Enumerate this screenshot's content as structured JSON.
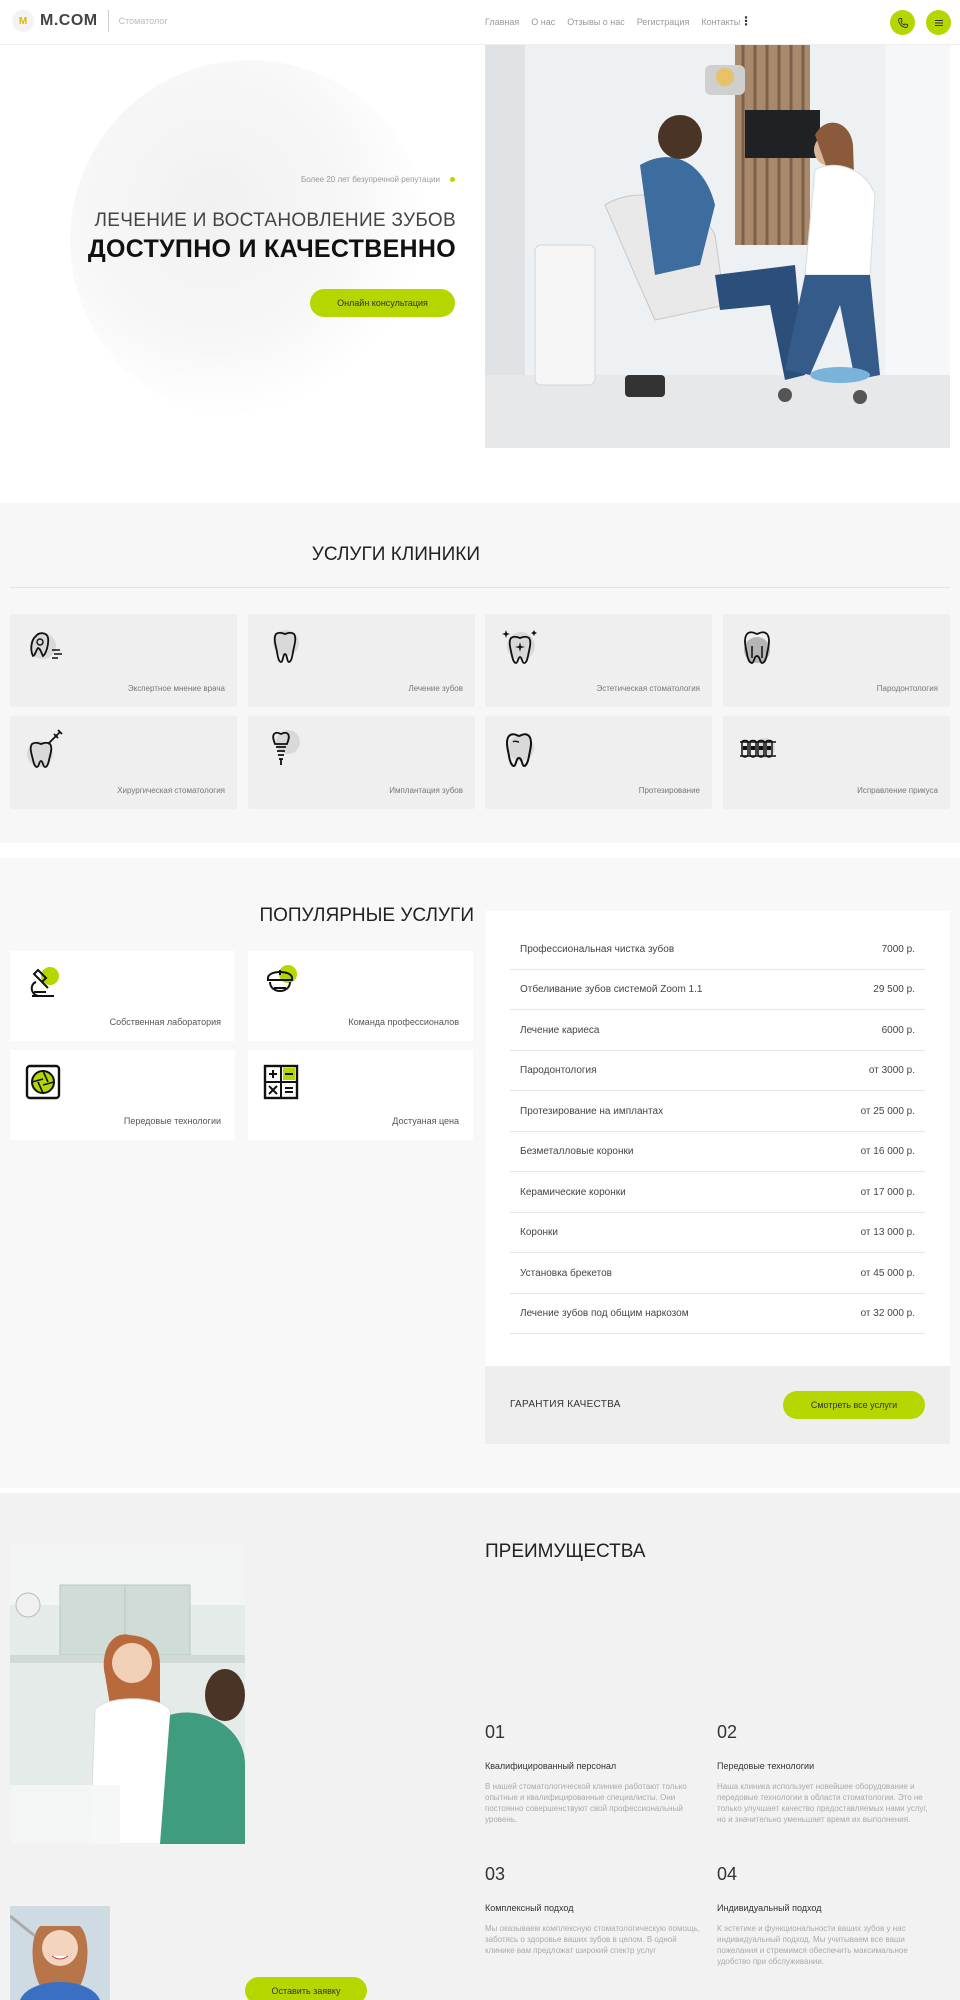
{
  "header": {
    "logo_mark": "M",
    "logo_text": "M.COM",
    "logo_subtitle": "Стоматолог",
    "nav": [
      "Главная",
      "О нас",
      "Отзывы о нас",
      "Регистрация",
      "Контакты"
    ],
    "more": "⋮",
    "accent": "#b6d600"
  },
  "hero": {
    "tagline": "Более 20 лет безупречной репутации",
    "line1": "ЛЕЧЕНИЕ И ВОСТАНОВЛЕНИЕ ЗУБОВ",
    "line2": "ДОСТУПНО И КАЧЕСТВЕННО",
    "cta": "Онлайн консультация"
  },
  "services": {
    "title": "УСЛУГИ КЛИНИКИ",
    "items": [
      {
        "label": "Экспертное мнение врача",
        "icon": "tooth-doctor-icon"
      },
      {
        "label": "Лечение зубов",
        "icon": "tooth-icon"
      },
      {
        "label": "Эстетическая стоматология",
        "icon": "sparkle-tooth-icon"
      },
      {
        "label": "Пародонтология",
        "icon": "tooth-gum-icon"
      },
      {
        "label": "Хирургическая стоматология",
        "icon": "tooth-surgery-icon"
      },
      {
        "label": "Имплантация зубов",
        "icon": "implant-icon"
      },
      {
        "label": "Протезирование",
        "icon": "prosthesis-icon"
      },
      {
        "label": "Исправление прикуса",
        "icon": "braces-icon"
      }
    ]
  },
  "popular": {
    "title": "ПОПУЛЯРНЫЕ УСЛУГИ",
    "features": [
      {
        "label": "Собственная лаборатория",
        "icon": "microscope-icon"
      },
      {
        "label": "Команда профессионалов",
        "icon": "nurse-icon"
      },
      {
        "label": "Передовые технологии",
        "icon": "aperture-icon"
      },
      {
        "label": "Достуаная цена",
        "icon": "calculator-icon"
      }
    ],
    "prices": [
      {
        "name": "Профессиональная чистка зубов",
        "price": "7000 р."
      },
      {
        "name": "Отбеливание зубов системой Zoom 1.1",
        "price": "29 500 р."
      },
      {
        "name": "Лечение кариеса",
        "price": "6000 р."
      },
      {
        "name": "Пародонтология",
        "price": "от 3000 р."
      },
      {
        "name": "Протезирование на имплантах",
        "price": "от 25 000 р."
      },
      {
        "name": "Безметалловые коронки",
        "price": "от 16 000 р."
      },
      {
        "name": "Керамические коронки",
        "price": "от 17 000 р."
      },
      {
        "name": "Коронки",
        "price": "от 13 000 р."
      },
      {
        "name": "Установка брекетов",
        "price": "от 45 000 р."
      },
      {
        "name": "Лечение зубов под общим наркозом",
        "price": "от 32 000 р."
      }
    ],
    "guarantee": "ГАРАНТИЯ КАЧЕСТВА",
    "all_services": "Смотреть все услуги"
  },
  "advantages": {
    "title": "ПРЕИМУЩЕСТВА",
    "items": [
      {
        "num": "01",
        "title": "Квалифицированный персонал",
        "text": "В нашей стоматологической клинике работают только опытные и квалифицированные специалисты. Они постоянно совершенствуют свой профессиональный уровень."
      },
      {
        "num": "02",
        "title": "Передовые технологии",
        "text": "Наша клиника использует новейшее оборудование и передовые технологии в области стоматологии. Это не только улучшает качество предоставляемых нами услуг, но и значительно уменьшает время их выполнения."
      },
      {
        "num": "03",
        "title": "Комплексный подход",
        "text": "Мы оказываем комплексную стоматологическую помощь, заботясь о здоровье ваших зубов в целом. В одной клинике вам предложат широкий спектр услуг"
      },
      {
        "num": "04",
        "title": "Индивидуальный подход",
        "text": "К эстетике и функциональности ваших зубов у нас индивидуальный подход. Мы учитываем все ваши пожелания и стремимся обеспечить максимальное удобство при обслуживании."
      }
    ],
    "cta": "Оставить заявку"
  }
}
